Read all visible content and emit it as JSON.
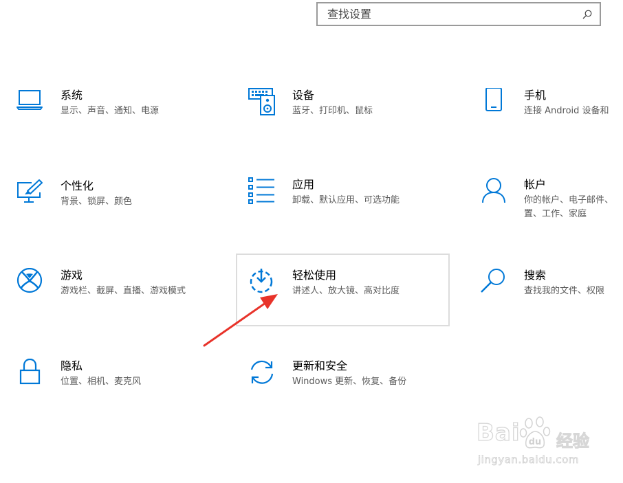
{
  "search": {
    "placeholder": "查找设置",
    "icon": "search-icon"
  },
  "accent_color": "#0078d7",
  "tiles": [
    {
      "title": "系统",
      "desc": "显示、声音、通知、电源",
      "icon": "laptop-icon"
    },
    {
      "title": "设备",
      "desc": "蓝牙、打印机、鼠标",
      "icon": "keyboard-speaker-icon"
    },
    {
      "title": "手机",
      "desc": "连接 Android 设备和",
      "icon": "phone-icon"
    },
    {
      "title": "个性化",
      "desc": "背景、锁屏、颜色",
      "icon": "paint-monitor-icon"
    },
    {
      "title": "应用",
      "desc": "卸载、默认应用、可选功能",
      "icon": "apps-list-icon"
    },
    {
      "title": "帐户",
      "desc": "你的帐户、电子邮件、\n置、工作、家庭",
      "icon": "person-icon"
    },
    {
      "title": "游戏",
      "desc": "游戏栏、截屏、直播、游戏模式",
      "icon": "xbox-icon"
    },
    {
      "title": "轻松使用",
      "desc": "讲述人、放大镜、高对比度",
      "icon": "ease-of-access-icon"
    },
    {
      "title": "搜索",
      "desc": "查找我的文件、权限",
      "icon": "magnifier-icon"
    },
    {
      "title": "隐私",
      "desc": "位置、相机、麦克风",
      "icon": "lock-icon"
    },
    {
      "title": "更新和安全",
      "desc": "Windows 更新、恢复、备份",
      "icon": "sync-icon"
    }
  ],
  "annotation": {
    "color": "#e8332a",
    "icon": "red-arrow-icon"
  },
  "watermark": {
    "brand": "Bai",
    "brand2": "经验",
    "url": "jingyan.baidu.com",
    "icon": "baidu-paw-icon"
  }
}
